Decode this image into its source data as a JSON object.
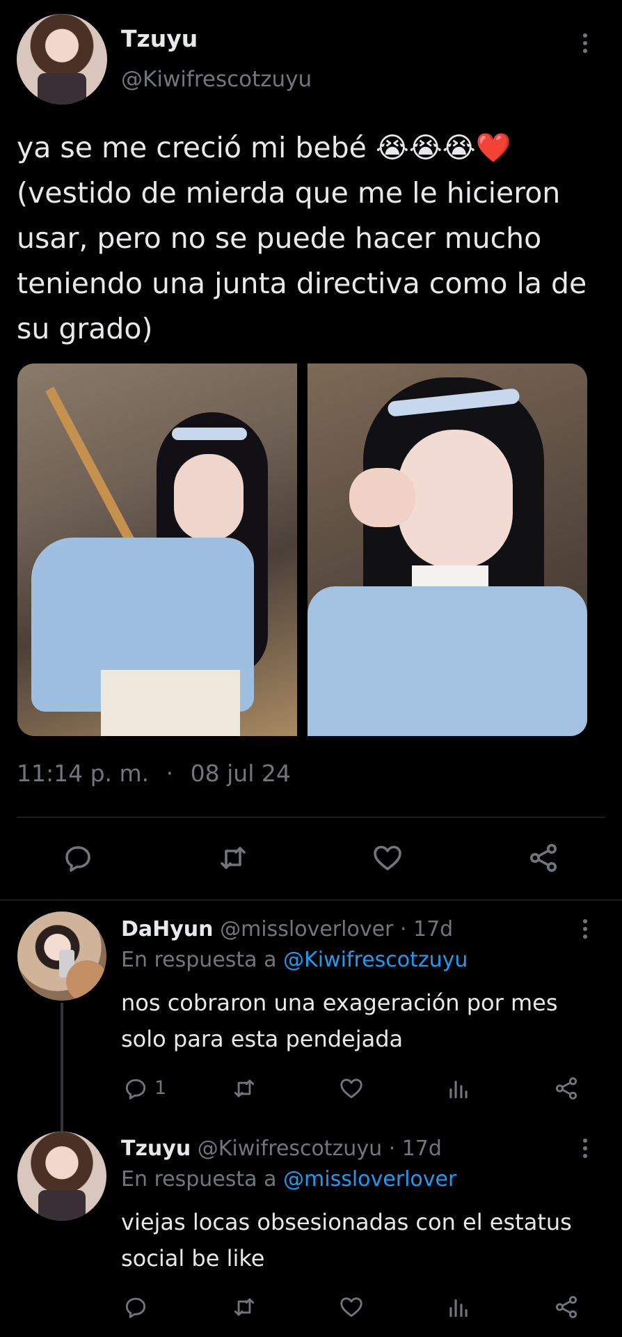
{
  "tweet": {
    "author_name": "Tzuyu",
    "author_handle": "@Kiwifrescotzuyu",
    "text_line1": "ya se me creció mi bebé 😭😭😭❤️",
    "text_line2": "(vestido de mierda que me le hicieron",
    "text_line3": "usar, pero no se puede hacer mucho",
    "text_line4": "teniendo una junta directiva como la de",
    "text_line5": "su grado)",
    "time": "11:14 p. m.",
    "separator": "·",
    "date": "08 jul 24"
  },
  "replies": [
    {
      "name": "DaHyun",
      "handle": "@missloverlover",
      "age": "· 17d",
      "reply_prefix": "En respuesta a",
      "reply_to": "@Kiwifrescotzuyu",
      "line1": "nos cobraron una exageración por mes",
      "line2": "solo para esta pendejada",
      "reply_count": "1"
    },
    {
      "name": "Tzuyu",
      "handle": "@Kiwifrescotzuyu",
      "age": "· 17d",
      "reply_prefix": "En respuesta a",
      "reply_to": "@missloverlover",
      "line1": "viejas locas obsesionadas con el estatus",
      "line2": "social be like"
    }
  ],
  "icons": {
    "reply": "reply-icon",
    "retweet": "retweet-icon",
    "like": "heart-icon",
    "share": "share-icon",
    "views": "views-icon",
    "more": "more-icon"
  },
  "colors": {
    "background": "#000000",
    "text": "#e7e9ea",
    "muted": "#71767b",
    "link": "#1d9bf0"
  }
}
